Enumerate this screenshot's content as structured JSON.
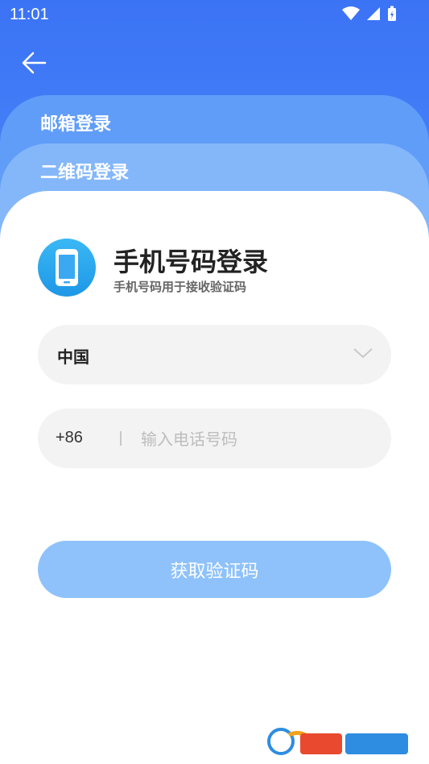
{
  "status_bar": {
    "time": "11:01"
  },
  "tabs": {
    "email_label": "邮箱登录",
    "qr_label": "二维码登录"
  },
  "login": {
    "title": "手机号码登录",
    "subtitle": "手机号码用于接收验证码",
    "country": "中国",
    "country_code": "+86",
    "phone_placeholder": "输入电话号码",
    "phone_value": "",
    "get_code_label": "获取验证码"
  },
  "colors": {
    "header_blue": "#3B73F5",
    "button_disabled": "#8FC2FA",
    "field_bg": "#F3F3F3"
  }
}
